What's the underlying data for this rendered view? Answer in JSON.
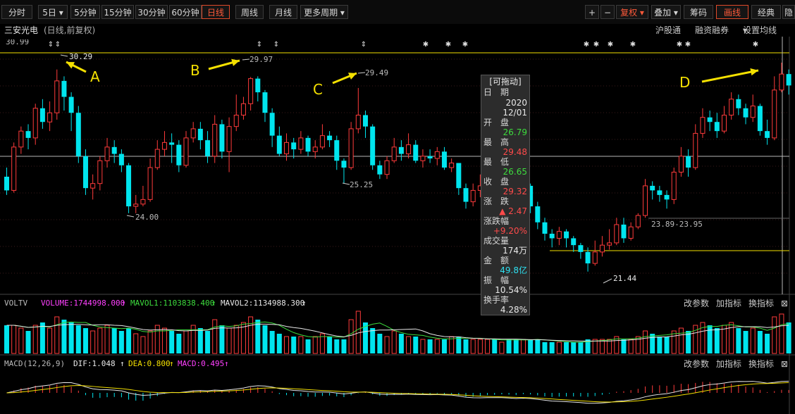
{
  "toolbar": {
    "periods": [
      "分时",
      "5日",
      "5分钟",
      "15分钟",
      "30分钟",
      "60分钟",
      "日线",
      "周线",
      "月线",
      "更多周期"
    ],
    "active_period": "日线",
    "right_buttons": [
      "+",
      "−",
      "复权",
      "叠加",
      "筹码",
      "画线",
      "经典",
      "隐"
    ]
  },
  "header": {
    "stock_name": "三安光电",
    "mode": "(日线,前复权)",
    "links": [
      "沪股通",
      "融资融券",
      "设置均线"
    ]
  },
  "annotations": {
    "A": "A",
    "B": "B",
    "C": "C",
    "D": "D",
    "price_labels": [
      "30.29",
      "29.97",
      "29.49",
      "24.00",
      "25.25",
      "21.44",
      "23.89-23.95"
    ],
    "top_cut_label": "30.99"
  },
  "tooltip": {
    "title": "[可拖动]",
    "date_label": "日　期",
    "year": "2020",
    "md": "12/01",
    "open_label": "开　盘",
    "open": "26.79",
    "high_label": "最　高",
    "high": "29.48",
    "low_label": "最　低",
    "low": "26.65",
    "close_label": "收　盘",
    "close": "29.32",
    "chg_label": "涨　跌",
    "chg": "▲ 2.47",
    "pct_label": "涨跌幅",
    "pct": "+9.20%",
    "vol_label": "成交量",
    "vol": "174万",
    "amt_label": "金　额",
    "amt": "49.8亿",
    "amp_label": "振　幅",
    "amp": "10.54%",
    "turn_label": "换手率",
    "turn": "4.28%"
  },
  "volume_panel": {
    "name": "VOLTV",
    "volume": "VOLUME:1744998.000",
    "mavol1": "MAVOL1:1103838.400",
    "mavol2": "MAVOL2:1134988.300",
    "links": [
      "改参数",
      "加指标",
      "换指标"
    ]
  },
  "macd_panel": {
    "name": "MACD(12,26,9)",
    "dif": "DIF:1.048",
    "dea": "DEA:0.800",
    "macd": "MACD:0.495",
    "links": [
      "改参数",
      "加指标",
      "换指标"
    ]
  },
  "colors": {
    "up": "#ff3b3b",
    "down": "#00e5ee",
    "yellow": "#f4e000",
    "white": "#e8e8e8",
    "magenta": "#ff40ff",
    "green": "#3ddc3d"
  },
  "chart_data": {
    "type": "candlestick",
    "ylim": [
      21.0,
      31.0
    ],
    "annotated_prices": [
      30.29,
      29.97,
      29.49,
      24.0,
      25.25,
      21.44,
      23.92
    ],
    "candles": [
      [
        25.6,
        25.0,
        26.0,
        24.8
      ],
      [
        25.0,
        26.9,
        27.1,
        24.9
      ],
      [
        26.9,
        27.6,
        27.8,
        26.6
      ],
      [
        27.6,
        27.3,
        27.9,
        26.8
      ],
      [
        27.3,
        28.6,
        28.8,
        27.0
      ],
      [
        28.6,
        28.0,
        29.0,
        27.7
      ],
      [
        28.0,
        28.4,
        28.9,
        27.6
      ],
      [
        28.4,
        29.8,
        30.3,
        28.1
      ],
      [
        29.8,
        29.1,
        30.0,
        28.5
      ],
      [
        29.1,
        28.4,
        29.3,
        27.6
      ],
      [
        28.4,
        26.5,
        28.7,
        26.2
      ],
      [
        26.5,
        25.1,
        26.8,
        24.8
      ],
      [
        25.1,
        25.3,
        25.7,
        24.6
      ],
      [
        25.3,
        26.3,
        26.5,
        25.0
      ],
      [
        26.3,
        26.9,
        27.3,
        26.0
      ],
      [
        26.9,
        26.6,
        27.2,
        26.2
      ],
      [
        26.6,
        26.1,
        26.8,
        25.8
      ],
      [
        26.1,
        24.3,
        26.2,
        24.0
      ],
      [
        24.3,
        24.4,
        24.8,
        24.0
      ],
      [
        24.4,
        24.6,
        25.2,
        24.3
      ],
      [
        24.6,
        26.0,
        26.4,
        24.5
      ],
      [
        26.0,
        26.8,
        27.2,
        25.9
      ],
      [
        26.8,
        27.1,
        27.6,
        26.5
      ],
      [
        27.1,
        27.0,
        27.5,
        26.2
      ],
      [
        27.0,
        26.1,
        27.2,
        25.8
      ],
      [
        26.1,
        27.3,
        27.6,
        26.0
      ],
      [
        27.3,
        27.7,
        28.0,
        27.1
      ],
      [
        27.7,
        27.2,
        28.0,
        26.8
      ],
      [
        27.2,
        26.5,
        27.6,
        26.2
      ],
      [
        26.5,
        27.9,
        28.3,
        26.2
      ],
      [
        27.9,
        26.7,
        28.1,
        26.4
      ],
      [
        26.7,
        27.8,
        28.2,
        25.8
      ],
      [
        27.8,
        28.3,
        29.2,
        27.6
      ],
      [
        28.3,
        28.8,
        29.1,
        28.1
      ],
      [
        28.8,
        29.9,
        29.97,
        28.5
      ],
      [
        29.9,
        29.3,
        30.0,
        28.9
      ],
      [
        29.3,
        28.4,
        29.4,
        28.0
      ],
      [
        28.4,
        27.4,
        28.6,
        26.9
      ],
      [
        27.4,
        26.6,
        27.8,
        26.5
      ],
      [
        26.6,
        27.1,
        27.5,
        26.3
      ],
      [
        27.1,
        26.8,
        27.3,
        26.4
      ],
      [
        26.8,
        27.3,
        27.6,
        26.6
      ],
      [
        27.3,
        26.7,
        27.4,
        26.5
      ],
      [
        26.7,
        26.9,
        27.2,
        26.4
      ],
      [
        26.9,
        27.4,
        27.9,
        26.8
      ],
      [
        27.4,
        27.2,
        27.6,
        26.9
      ],
      [
        27.2,
        26.3,
        27.4,
        25.9
      ],
      [
        26.3,
        26.0,
        26.4,
        25.3
      ],
      [
        26.0,
        27.7,
        28.0,
        25.9
      ],
      [
        27.7,
        28.3,
        29.49,
        27.5
      ],
      [
        28.3,
        27.8,
        28.5,
        27.3
      ],
      [
        27.8,
        26.1,
        27.9,
        25.9
      ],
      [
        26.1,
        25.7,
        26.3,
        25.5
      ],
      [
        25.7,
        26.3,
        26.5,
        25.5
      ],
      [
        26.3,
        26.9,
        27.3,
        26.2
      ],
      [
        26.9,
        26.6,
        27.2,
        26.3
      ],
      [
        26.6,
        27.0,
        27.5,
        26.4
      ],
      [
        27.0,
        26.3,
        27.2,
        26.2
      ],
      [
        26.3,
        26.5,
        26.8,
        26.0
      ],
      [
        26.5,
        26.4,
        26.8,
        26.2
      ],
      [
        26.4,
        26.7,
        26.9,
        26.1
      ],
      [
        26.7,
        26.0,
        26.9,
        25.9
      ],
      [
        26.0,
        26.2,
        26.4,
        25.8
      ],
      [
        26.2,
        25.1,
        26.2,
        24.8
      ],
      [
        25.1,
        24.5,
        25.3,
        24.2
      ],
      [
        24.5,
        25.0,
        25.3,
        24.3
      ],
      [
        25.0,
        25.2,
        25.7,
        24.7
      ],
      [
        25.2,
        25.6,
        25.9,
        25.0
      ],
      [
        25.6,
        25.2,
        25.8,
        24.9
      ],
      [
        25.2,
        25.3,
        25.5,
        24.9
      ],
      [
        25.3,
        24.7,
        25.5,
        24.5
      ],
      [
        24.7,
        24.3,
        25.0,
        24.0
      ],
      [
        24.3,
        25.2,
        25.3,
        24.2
      ],
      [
        25.2,
        24.3,
        25.3,
        24.0
      ],
      [
        24.3,
        23.6,
        24.5,
        23.3
      ],
      [
        23.6,
        23.1,
        23.8,
        22.8
      ],
      [
        23.1,
        22.9,
        23.3,
        22.5
      ],
      [
        22.9,
        23.2,
        23.4,
        22.6
      ],
      [
        23.2,
        22.9,
        23.3,
        22.5
      ],
      [
        22.9,
        22.6,
        23.0,
        22.3
      ],
      [
        22.6,
        22.3,
        22.7,
        22.0
      ],
      [
        22.3,
        21.8,
        22.5,
        21.44
      ],
      [
        21.8,
        22.3,
        22.8,
        21.7
      ],
      [
        22.3,
        22.6,
        23.0,
        22.1
      ],
      [
        22.6,
        22.7,
        23.3,
        22.4
      ],
      [
        22.7,
        23.5,
        23.8,
        22.6
      ],
      [
        23.5,
        22.9,
        23.8,
        22.7
      ],
      [
        22.9,
        23.4,
        23.6,
        22.8
      ],
      [
        23.4,
        23.9,
        24.0,
        23.3
      ],
      [
        23.9,
        25.2,
        25.5,
        23.8
      ],
      [
        25.2,
        25.0,
        25.4,
        24.6
      ],
      [
        25.0,
        24.8,
        25.2,
        24.5
      ],
      [
        24.8,
        24.6,
        25.0,
        24.2
      ],
      [
        24.6,
        25.8,
        26.0,
        24.4
      ],
      [
        25.8,
        26.5,
        26.9,
        25.6
      ],
      [
        26.5,
        26.0,
        26.8,
        25.6
      ],
      [
        26.0,
        27.5,
        27.9,
        25.9
      ],
      [
        27.5,
        28.2,
        28.6,
        27.3
      ],
      [
        28.2,
        28.0,
        28.5,
        27.6
      ],
      [
        28.0,
        27.6,
        28.4,
        27.3
      ],
      [
        27.6,
        28.3,
        28.7,
        27.5
      ],
      [
        28.3,
        29.0,
        29.3,
        28.1
      ],
      [
        29.0,
        28.6,
        29.2,
        28.3
      ],
      [
        28.6,
        28.2,
        28.8,
        27.9
      ],
      [
        28.2,
        28.7,
        29.2,
        28.0
      ],
      [
        28.7,
        27.6,
        28.8,
        27.4
      ],
      [
        27.6,
        27.3,
        28.1,
        27.0
      ],
      [
        27.3,
        29.4,
        30.0,
        27.2
      ],
      [
        29.4,
        30.1,
        30.6,
        29.3
      ],
      [
        30.1,
        29.6,
        30.3,
        29.2
      ]
    ],
    "volume_ratio": [
      1.0,
      1.0,
      0.9,
      0.8,
      1.0,
      1.1,
      0.9,
      1.3,
      1.2,
      1.1,
      1.0,
      0.9,
      0.8,
      0.9,
      1.0,
      0.9,
      0.8,
      0.9,
      0.7,
      0.6,
      0.8,
      1.0,
      0.9,
      0.8,
      0.7,
      0.8,
      1.0,
      0.9,
      0.8,
      1.2,
      1.0,
      0.9,
      1.0,
      1.1,
      1.3,
      1.2,
      1.0,
      0.8,
      0.7,
      0.6,
      0.6,
      0.6,
      0.5,
      0.6,
      0.7,
      0.6,
      0.5,
      0.5,
      1.2,
      1.5,
      1.1,
      0.9,
      0.7,
      0.6,
      0.8,
      0.7,
      0.6,
      0.6,
      0.5,
      0.5,
      0.5,
      0.5,
      0.6,
      0.6,
      0.5,
      0.5,
      0.5,
      0.5,
      0.5,
      0.4,
      0.5,
      0.5,
      0.5,
      0.5,
      0.5,
      0.4,
      0.4,
      0.4,
      0.4,
      0.4,
      0.4,
      0.5,
      0.5,
      0.5,
      0.5,
      0.6,
      0.5,
      0.5,
      0.6,
      0.8,
      0.7,
      0.6,
      0.6,
      0.8,
      0.9,
      0.8,
      1.0,
      1.1,
      1.0,
      0.9,
      1.0,
      1.1,
      0.9,
      0.8,
      0.9,
      0.8,
      0.7,
      1.3,
      1.4,
      1.1
    ]
  }
}
